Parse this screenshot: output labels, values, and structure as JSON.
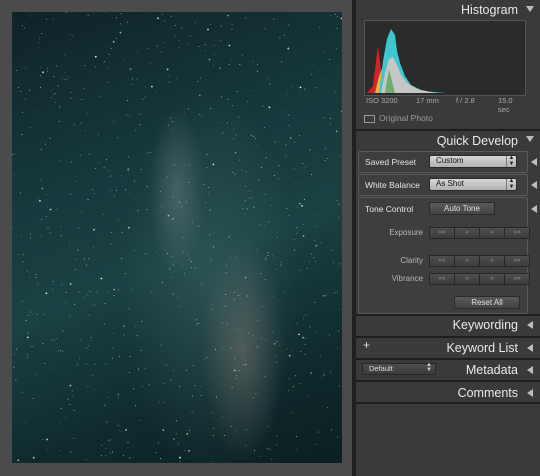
{
  "histogram": {
    "title": "Histogram",
    "iso": "ISO 3200",
    "focal": "17 mm",
    "aperture": "f / 2.8",
    "shutter": "15.0 sec",
    "original_photo": "Original Photo"
  },
  "quick_develop": {
    "title": "Quick Develop",
    "saved_preset_label": "Saved Preset",
    "saved_preset_value": "Custom",
    "white_balance_label": "White Balance",
    "white_balance_value": "As Shot",
    "tone_control_label": "Tone Control",
    "auto_tone": "Auto Tone",
    "exposure": "Exposure",
    "clarity": "Clarity",
    "vibrance": "Vibrance",
    "step_ll": "««",
    "step_l": "«",
    "step_r": "»",
    "step_rr": "»»",
    "reset_all": "Reset All"
  },
  "keywording": {
    "title": "Keywording"
  },
  "keyword_list": {
    "title": "Keyword List",
    "plus": "+"
  },
  "metadata": {
    "title": "Metadata",
    "preset": "Default"
  },
  "comments": {
    "title": "Comments"
  }
}
